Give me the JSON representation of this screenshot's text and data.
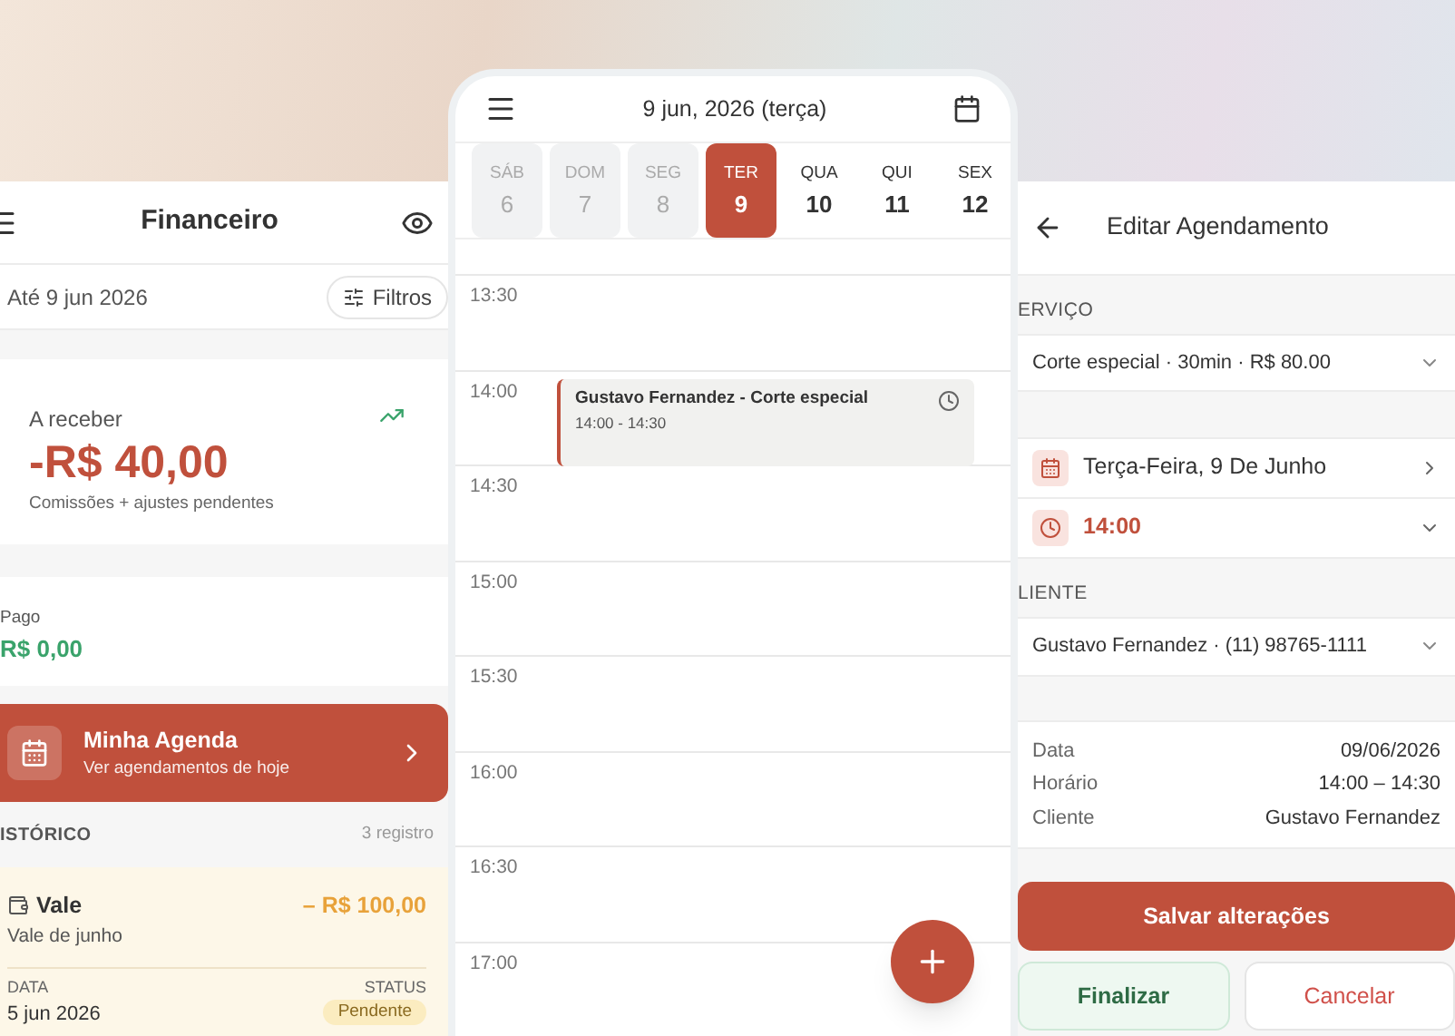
{
  "finance": {
    "title": "Financeiro",
    "period": "Até 9 jun 2026",
    "filter_button": "Filtros",
    "receivable": {
      "label": "A receber",
      "amount": "-R$ 40,00",
      "note": "Comissões + ajustes pendentes"
    },
    "paid": {
      "label": "Pago",
      "amount": "R$ 0,00"
    },
    "agenda_banner": {
      "title": "Minha Agenda",
      "subtitle": "Ver agendamentos de hoje"
    },
    "history": {
      "heading": "ISTÓRICO",
      "count": "3 registro",
      "entries": [
        {
          "title": "Vale",
          "description": "Vale de junho",
          "amount": "– R$ 100,00",
          "date_label": "DATA",
          "date": "5 jun 2026",
          "status_label": "STATUS",
          "status": "Pendente"
        }
      ]
    }
  },
  "calendar": {
    "title": "9 jun, 2026 (terça)",
    "days": [
      {
        "weekday": "SÁB",
        "day": "6",
        "past": true,
        "selected": false
      },
      {
        "weekday": "DOM",
        "day": "7",
        "past": true,
        "selected": false
      },
      {
        "weekday": "SEG",
        "day": "8",
        "past": true,
        "selected": false
      },
      {
        "weekday": "TER",
        "day": "9",
        "past": false,
        "selected": true
      },
      {
        "weekday": "QUA",
        "day": "10",
        "past": false,
        "selected": false
      },
      {
        "weekday": "QUI",
        "day": "11",
        "past": false,
        "selected": false
      },
      {
        "weekday": "SEX",
        "day": "12",
        "past": false,
        "selected": false
      }
    ],
    "slots": [
      {
        "time": "13:30"
      },
      {
        "time": "14:00",
        "event": {
          "title": "Gustavo Fernandez - Corte especial",
          "time": "14:00 - 14:30"
        }
      },
      {
        "time": "14:30"
      },
      {
        "time": "15:00"
      },
      {
        "time": "15:30"
      },
      {
        "time": "16:00"
      },
      {
        "time": "16:30"
      },
      {
        "time": "17:00"
      }
    ]
  },
  "editor": {
    "title": "Editar Agendamento",
    "service_label": "ERVIÇO",
    "service": "Corte especial · 30min · R$ 80.00",
    "date": "Terça-Feira, 9 De Junho",
    "time": "14:00",
    "client_label": "LIENTE",
    "client": "Gustavo Fernandez · (11) 98765-1111",
    "summary": [
      {
        "label": "Data",
        "value": "09/06/2026"
      },
      {
        "label": "Horário",
        "value": "14:00 – 14:30"
      },
      {
        "label": "Cliente",
        "value": "Gustavo Fernandez"
      }
    ],
    "save_button": "Salvar alterações",
    "finish_button": "Finalizar",
    "cancel_button": "Cancelar"
  }
}
